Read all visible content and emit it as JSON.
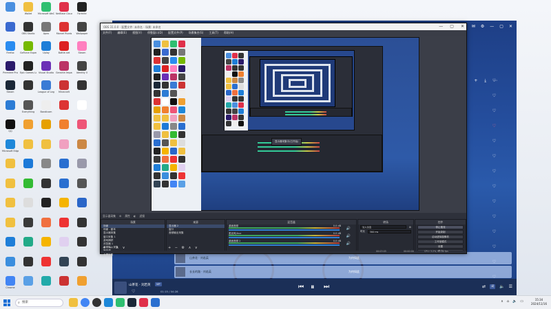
{
  "desktop": {
    "icons": [
      {
        "label": "",
        "color": "#4a8fe0"
      },
      {
        "label": "Wallet",
        "color": "#f0c040"
      },
      {
        "label": "Microsoft WeChat",
        "color": "#2fbf71"
      },
      {
        "label": "NetEase Cloud",
        "color": "#e0304a"
      },
      {
        "label": "Fortnite",
        "color": "#222"
      },
      {
        "label": "",
        "color": "#3a6ad0"
      },
      {
        "label": "OBS Studio",
        "color": "#333"
      },
      {
        "label": "Apex",
        "color": "#777"
      },
      {
        "label": "Marvel Rivals",
        "color": "#d33"
      },
      {
        "label": "Wallpaper",
        "color": "#444"
      },
      {
        "label": "Firefox",
        "color": "#2a8cf0"
      },
      {
        "label": "GeForce Experience",
        "color": "#76b900"
      },
      {
        "label": "Uplay",
        "color": "#1e7ed8"
      },
      {
        "label": "Battle.net",
        "color": "#d22"
      },
      {
        "label": "Steam",
        "color": "#ff7fbf"
      },
      {
        "label": "Premiere Pro",
        "color": "#2a1a6a"
      },
      {
        "label": "Epic Games Launcher",
        "color": "#222"
      },
      {
        "label": "Visual Studio",
        "color": "#6b2fb6"
      },
      {
        "label": "Genshin Impact",
        "color": "#b36"
      },
      {
        "label": "Identity V",
        "color": "#444"
      },
      {
        "label": "Steam",
        "color": "#1b2838"
      },
      {
        "label": "",
        "color": "#333"
      },
      {
        "label": "League of Legends",
        "color": "#3a7bd5"
      },
      {
        "label": "Minecraft",
        "color": "#c33"
      },
      {
        "label": "",
        "color": "#333"
      },
      {
        "label": "",
        "color": "#2c7cd5"
      },
      {
        "label": "Everything",
        "color": "#555"
      },
      {
        "label": "Bandicam",
        "color": "#eee"
      },
      {
        "label": "",
        "color": "#d33"
      },
      {
        "label": "",
        "color": "#fff"
      },
      {
        "label": "QQ",
        "color": "#111"
      },
      {
        "label": "",
        "color": "#f0a030"
      },
      {
        "label": "",
        "color": "#e6a000"
      },
      {
        "label": "",
        "color": "#f08030"
      },
      {
        "label": "",
        "color": "#ee5577"
      },
      {
        "label": "Microsoft Edge",
        "color": "#1e88d9"
      },
      {
        "label": "",
        "color": "#f0c040"
      },
      {
        "label": "",
        "color": "#f0c040"
      },
      {
        "label": "",
        "color": "#f0a0c0"
      },
      {
        "label": "",
        "color": "#c84"
      },
      {
        "label": "",
        "color": "#f0c040"
      },
      {
        "label": "",
        "color": "#1d7ad8"
      },
      {
        "label": "",
        "color": "#888"
      },
      {
        "label": "",
        "color": "#2a6fd0"
      },
      {
        "label": "",
        "color": "#99a"
      },
      {
        "label": "",
        "color": "#f0c040"
      },
      {
        "label": "",
        "color": "#3b3"
      },
      {
        "label": "",
        "color": "#333"
      },
      {
        "label": "",
        "color": "#2a6fd0"
      },
      {
        "label": "",
        "color": "#555"
      },
      {
        "label": "",
        "color": "#f0c040"
      },
      {
        "label": "",
        "color": "#ddd"
      },
      {
        "label": "",
        "color": "#222"
      },
      {
        "label": "",
        "color": "#f5b400"
      },
      {
        "label": "",
        "color": "#2a66c8"
      },
      {
        "label": "",
        "color": "#f0c040"
      },
      {
        "label": "",
        "color": "#3a3a3a"
      },
      {
        "label": "",
        "color": "#f07040"
      },
      {
        "label": "",
        "color": "#e33"
      },
      {
        "label": "",
        "color": "#333"
      },
      {
        "label": "",
        "color": "#1e7ed8"
      },
      {
        "label": "",
        "color": "#2a8"
      },
      {
        "label": "",
        "color": "#f5b400"
      },
      {
        "label": "",
        "color": "#e0d0f0"
      },
      {
        "label": "",
        "color": "#333"
      },
      {
        "label": "",
        "color": "#3b8ede"
      },
      {
        "label": "",
        "color": "#333"
      },
      {
        "label": "",
        "color": "#e33"
      },
      {
        "label": "",
        "color": "#345"
      },
      {
        "label": "",
        "color": "#333"
      },
      {
        "label": "Chrome",
        "color": "#4285f4"
      },
      {
        "label": "",
        "color": "#5aa0e6"
      },
      {
        "label": "",
        "color": "#2aa"
      },
      {
        "label": "",
        "color": "#c33"
      },
      {
        "label": "",
        "color": "#f0a030"
      }
    ]
  },
  "player": {
    "song": "山茶花 - 刘若英",
    "tag": "VIP",
    "time": "01:15 / 04:28",
    "album_label": "为何如此",
    "rows": [
      {
        "title": "山茶花 · 刘若英",
        "album": "为何如此"
      },
      {
        "title": "长长的路 · 刘若英",
        "album": "为何如此"
      }
    ],
    "right_label": "词"
  },
  "obs": {
    "title": "OBS 31.0.0 - 配置文件: 未命名 - 场景: 未命名",
    "menu": [
      "文件(F)",
      "编辑(E)",
      "视图(V)",
      "停靠窗口(D)",
      "配置文件(P)",
      "场景集合(S)",
      "工具(T)",
      "帮助(H)"
    ],
    "no_source": "显示器采集",
    "popup_text": "显示器采集中(已开始)",
    "status_row": [
      "属性",
      "滤镜"
    ],
    "docks": {
      "scenes_head": "场景",
      "scenes": [
        "场景",
        "场景 - 副本",
        "显示器采集",
        "窗口采集 1",
        "游戏捕获",
        "浏览器 1",
        "音频输入采集",
        "媒体源",
        "全屏采集"
      ],
      "sources_head": "来源",
      "sources": [
        "显示器 2",
        "窗口",
        "音频输出采集"
      ],
      "mixer_head": "混音器",
      "mixer": [
        {
          "name": "桌面音频",
          "db": "0.0 dB"
        },
        {
          "name": "麦克风/Aux",
          "db": "0.0 dB"
        },
        {
          "name": "桌面音频 2",
          "db": "0.0 dB"
        }
      ],
      "transition_head": "转场",
      "transition_label": "淡入淡出",
      "duration_label": "时长",
      "duration_value": "300 ms",
      "controls_head": "控件",
      "controls": [
        "停止推流",
        "开始录制",
        "启动虚拟摄像机",
        "工作室模式",
        "设置",
        "退出"
      ]
    },
    "status": {
      "cpu": "CPU: 3.2%, 60.00 fps",
      "rec": "00:00:00",
      "live": "00:03:05"
    }
  },
  "taskbar": {
    "search_placeholder": "搜索",
    "time": "15:34",
    "date": "2024/11/16"
  },
  "colors": {
    "obs_bg": "#2b2e38",
    "player_blue": "#244d9c",
    "accent_green": "#3da55c"
  }
}
